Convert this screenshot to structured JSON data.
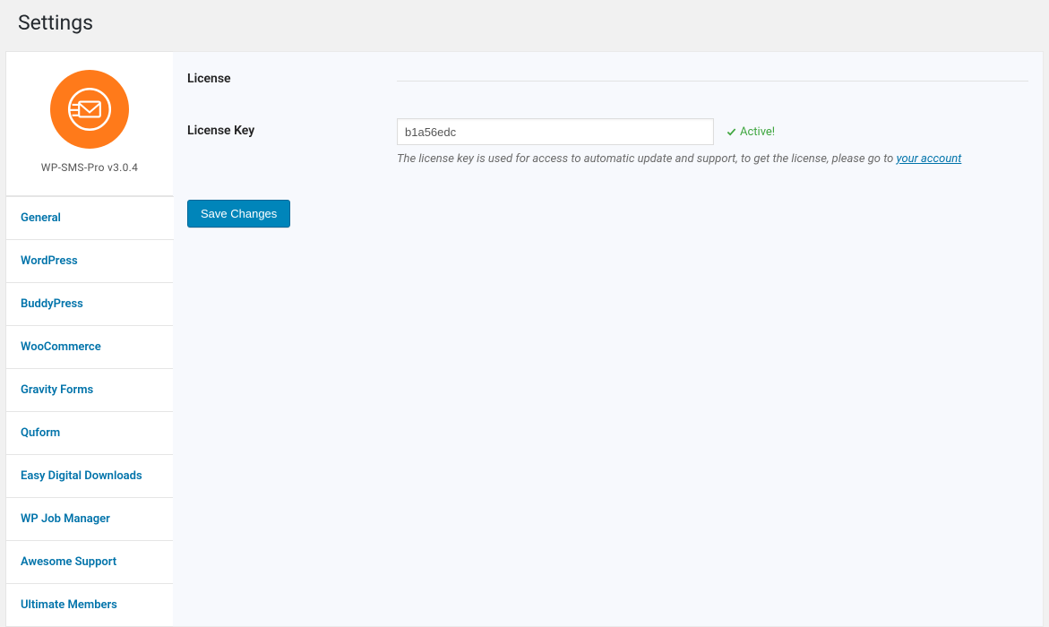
{
  "page_title": "Settings",
  "product": {
    "name": "WP-SMS-Pro v3.0.4"
  },
  "tabs": [
    {
      "label": "General",
      "active": true
    },
    {
      "label": "WordPress",
      "active": false
    },
    {
      "label": "BuddyPress",
      "active": false
    },
    {
      "label": "WooCommerce",
      "active": false
    },
    {
      "label": "Gravity Forms",
      "active": false
    },
    {
      "label": "Quform",
      "active": false
    },
    {
      "label": "Easy Digital Downloads",
      "active": false
    },
    {
      "label": "WP Job Manager",
      "active": false
    },
    {
      "label": "Awesome Support",
      "active": false
    },
    {
      "label": "Ultimate Members",
      "active": false
    }
  ],
  "section": {
    "heading": "License"
  },
  "license_field": {
    "label": "License Key",
    "value": "b1a56edc",
    "status": "Active!",
    "help_prefix": "The license key is used for access to automatic update and support, to get the license, please go to ",
    "help_link": "your account"
  },
  "save_button": "Save Changes",
  "colors": {
    "accent": "#0073aa",
    "brand": "#ff7a1a",
    "success": "#3fa63f"
  }
}
